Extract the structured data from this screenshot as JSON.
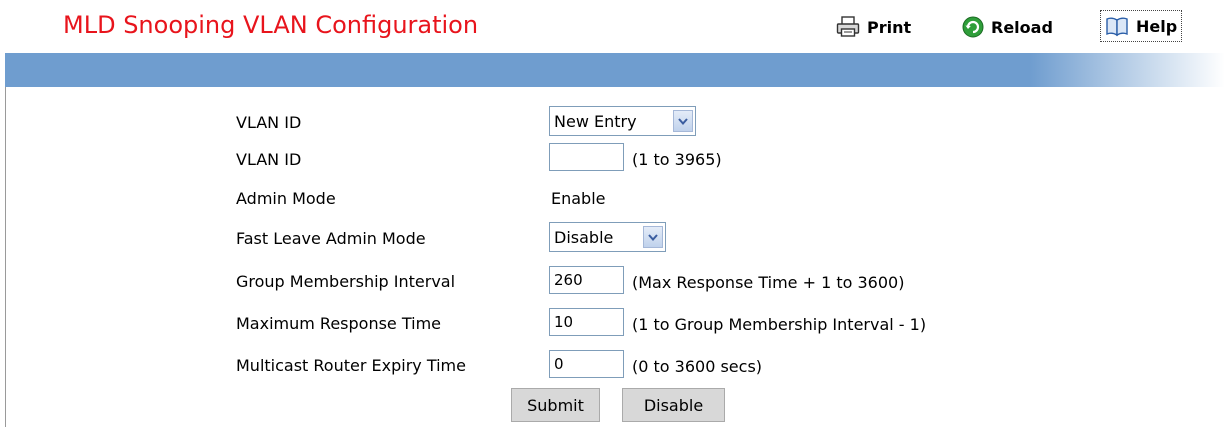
{
  "header": {
    "title": "MLD Snooping VLAN Configuration",
    "print_label": "Print",
    "reload_label": "Reload",
    "help_label": "Help",
    "accent_color": "#e8141c",
    "bar_color": "#6f9dcf"
  },
  "form": {
    "vlan_select": {
      "label": "VLAN ID",
      "value": "New Entry"
    },
    "vlan_id": {
      "label": "VLAN ID",
      "value": "",
      "hint": "(1 to 3965)"
    },
    "admin_mode": {
      "label": "Admin Mode",
      "value": "Enable"
    },
    "fast_leave": {
      "label": "Fast Leave Admin Mode",
      "value": "Disable"
    },
    "group_membership": {
      "label": "Group Membership Interval",
      "value": "260",
      "hint": "(Max Response Time + 1 to 3600)"
    },
    "max_response": {
      "label": "Maximum Response Time",
      "value": "10",
      "hint": "(1 to Group Membership Interval - 1)"
    },
    "router_expiry": {
      "label": "Multicast Router Expiry Time",
      "value": "0",
      "hint": "(0 to 3600 secs)"
    }
  },
  "buttons": {
    "submit_label": "Submit",
    "disable_label": "Disable"
  },
  "icons": {
    "print": "printer-icon",
    "reload": "reload-icon",
    "help": "help-book-icon",
    "dropdown": "chevron-down-icon"
  }
}
